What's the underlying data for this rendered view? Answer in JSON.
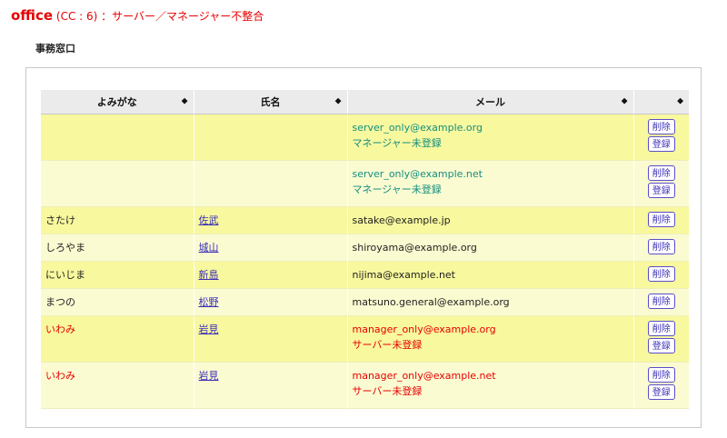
{
  "header": {
    "name": "office",
    "detail": " (CC : 6) ：サーバー／マネージャー不整合"
  },
  "section_title": "事務窓口",
  "table": {
    "columns": [
      "よみがな",
      "氏名",
      "メール",
      ""
    ],
    "rows": [
      {
        "kana": "",
        "name": "",
        "email": "server_only@example.org",
        "note": "マネージャー未登録",
        "delete": "削除",
        "register": "登録"
      },
      {
        "kana": "",
        "name": "",
        "email": "server_only@example.net",
        "note": "マネージャー未登録",
        "delete": "削除",
        "register": "登録"
      },
      {
        "kana": "さたけ",
        "name": "佐武",
        "email": "satake@example.jp",
        "note": "",
        "delete": "削除",
        "register": ""
      },
      {
        "kana": "しろやま",
        "name": "城山",
        "email": "shiroyama@example.org",
        "note": "",
        "delete": "削除",
        "register": ""
      },
      {
        "kana": "にいじま",
        "name": "新島",
        "email": "nijima@example.net",
        "note": "",
        "delete": "削除",
        "register": ""
      },
      {
        "kana": "まつの",
        "name": "松野",
        "email": "matsuno.general@example.org",
        "note": "",
        "delete": "削除",
        "register": ""
      },
      {
        "kana": "いわみ",
        "name": "岩見",
        "email": "manager_only@example.org",
        "note": "サーバー未登録",
        "delete": "削除",
        "register": "登録"
      },
      {
        "kana": "いわみ",
        "name": "岩見",
        "email": "manager_only@example.net",
        "note": "サーバー未登録",
        "delete": "削除",
        "register": "登録"
      }
    ]
  },
  "colors": {
    "warning_red": "#e60000",
    "teal_text": "#138f80",
    "row_odd": "#f8f89e",
    "row_even": "#fbfbd2",
    "link": "#3a2eb8"
  },
  "icons": {
    "sort": "sort-updown-icon"
  }
}
